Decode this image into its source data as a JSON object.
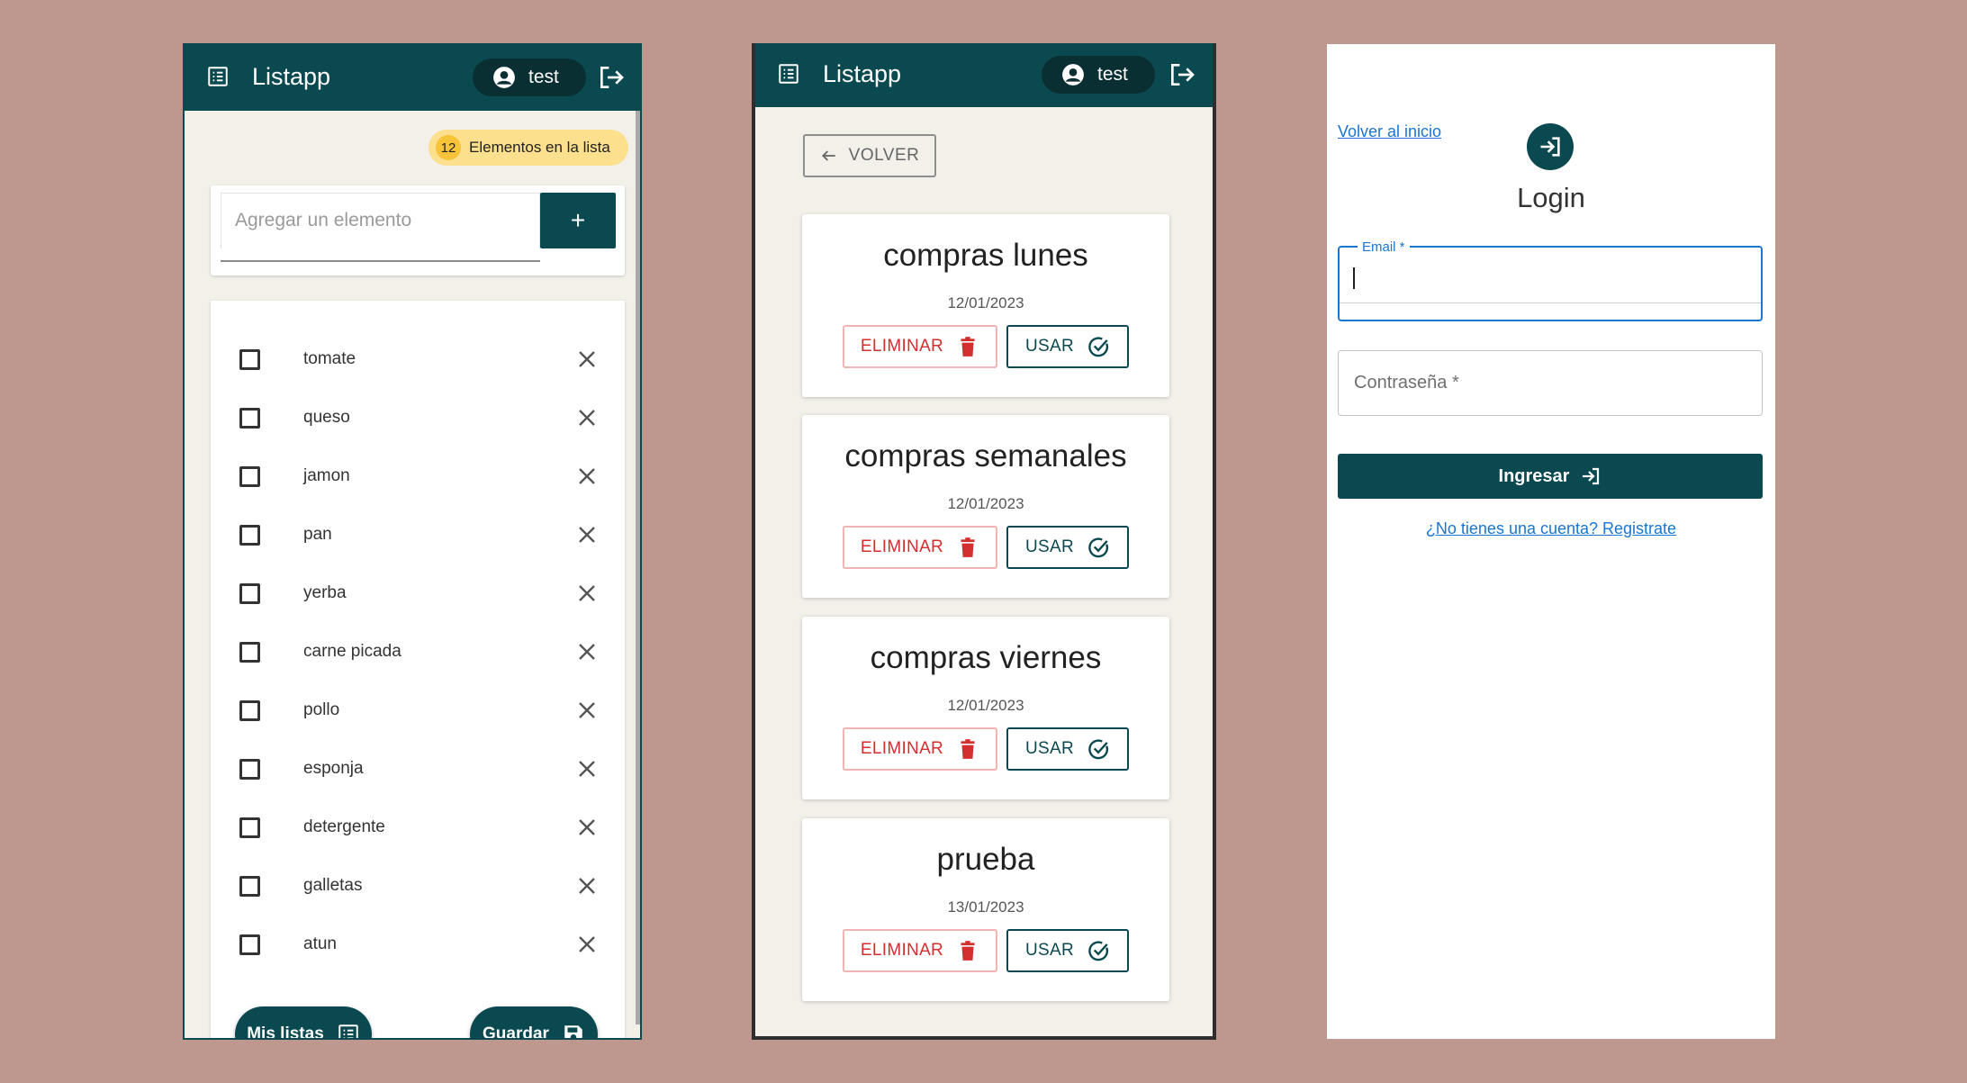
{
  "theme": {
    "primary": "#0b4950",
    "danger": "#d32f2f",
    "badge": "#fce08d",
    "link": "#1976d2",
    "background": "#be978e"
  },
  "list_screen": {
    "app_title": "Listapp",
    "user_name": "test",
    "badge": {
      "count": "12",
      "label": "Elementos en la lista"
    },
    "add_placeholder": "Agregar un elemento",
    "add_button": "+",
    "items": [
      {
        "label": "tomate",
        "checked": false
      },
      {
        "label": "queso",
        "checked": false
      },
      {
        "label": "jamon",
        "checked": false
      },
      {
        "label": "pan",
        "checked": false
      },
      {
        "label": "yerba",
        "checked": false
      },
      {
        "label": "carne picada",
        "checked": false
      },
      {
        "label": "pollo",
        "checked": false
      },
      {
        "label": "esponja",
        "checked": false
      },
      {
        "label": "detergente",
        "checked": false
      },
      {
        "label": "galletas",
        "checked": false
      },
      {
        "label": "atun",
        "checked": false
      }
    ],
    "my_lists_button": "Mis listas",
    "save_button": "Guardar"
  },
  "lists_screen": {
    "app_title": "Listapp",
    "user_name": "test",
    "back_button": "VOLVER",
    "lists": [
      {
        "title": "compras lunes",
        "date": "12/01/2023"
      },
      {
        "title": "compras semanales",
        "date": "12/01/2023"
      },
      {
        "title": "compras viernes",
        "date": "12/01/2023"
      },
      {
        "title": "prueba",
        "date": "13/01/2023"
      }
    ],
    "delete_label": "ELIMINAR",
    "use_label": "USAR"
  },
  "login_screen": {
    "back_link": "Volver al inicio",
    "title": "Login",
    "email_label": "Email *",
    "password_label": "Contraseña *",
    "submit_label": "Ingresar",
    "register_link": "¿No tienes una cuenta? Registrate"
  }
}
